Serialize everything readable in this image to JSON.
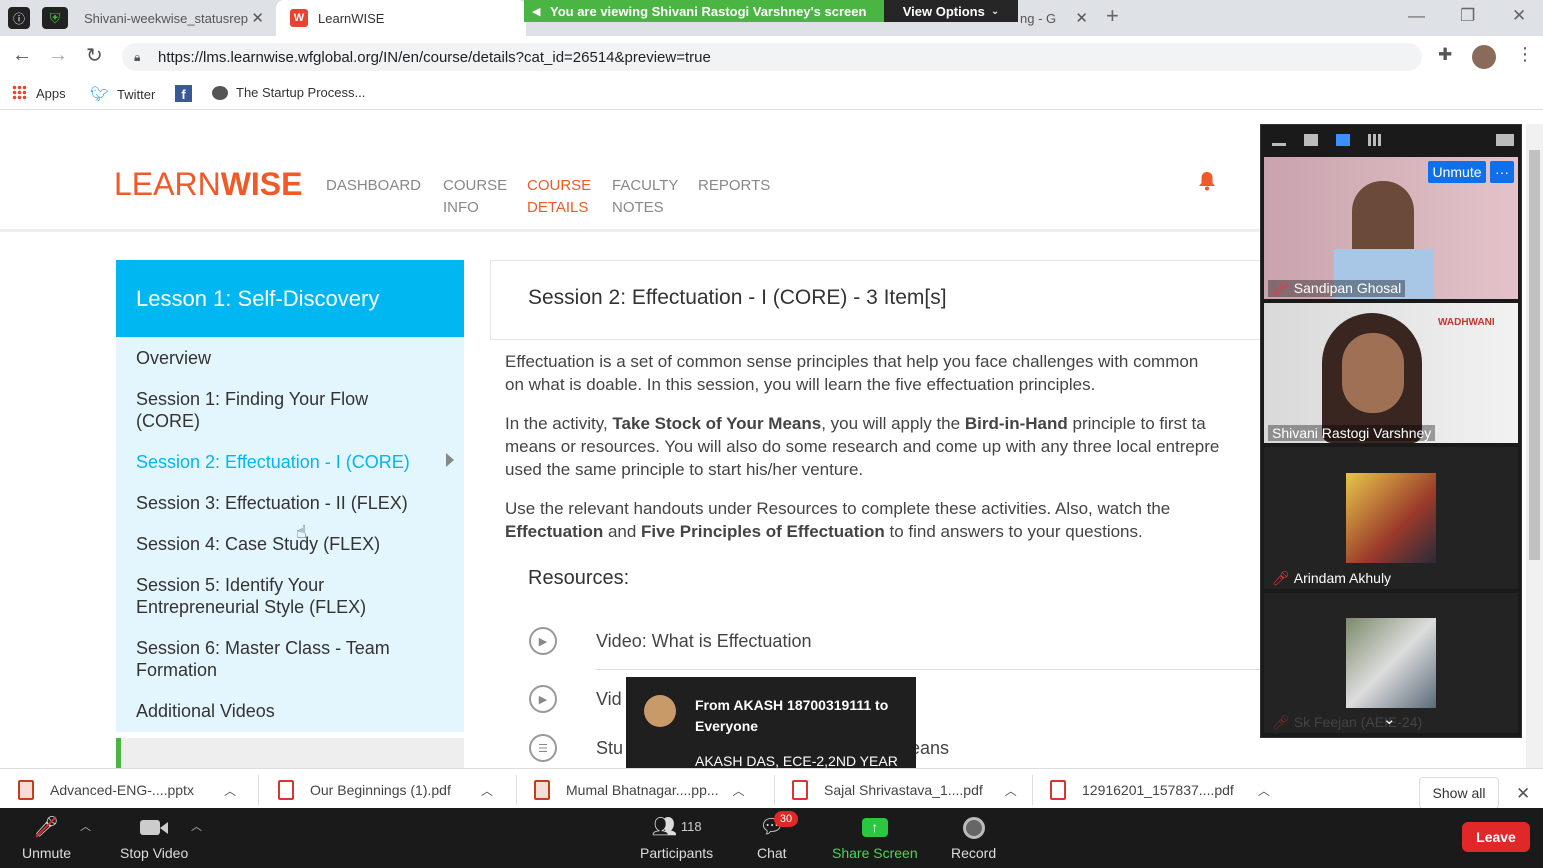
{
  "browser": {
    "tabs": [
      {
        "label": "Shivani-weekwise_statusrep"
      },
      {
        "label": "LearnWISE"
      },
      {
        "label": "ng - G"
      }
    ],
    "url": "https://lms.learnwise.wfglobal.org/IN/en/course/details?cat_id=26514&preview=true",
    "bookmarks": [
      "Apps",
      "Twitter",
      "The Startup Process..."
    ]
  },
  "share_banner": {
    "text": "You are viewing Shivani Rastogi Varshney's screen",
    "view_options": "View Options"
  },
  "site": {
    "logo_light": "LEARN",
    "logo_bold": "WISE",
    "nav": [
      {
        "line1": "DASHBOARD",
        "line2": ""
      },
      {
        "line1": "COURSE",
        "line2": "INFO"
      },
      {
        "line1": "COURSE",
        "line2": "DETAILS"
      },
      {
        "line1": "FACULTY",
        "line2": "NOTES"
      },
      {
        "line1": "REPORTS",
        "line2": ""
      }
    ]
  },
  "lesson": {
    "title": "Lesson 1: Self-Discovery",
    "items": [
      "Overview",
      "Session 1: Finding Your Flow (CORE)",
      "Session 2: Effectuation - I (CORE)",
      "Session 3: Effectuation - II (FLEX)",
      "Session 4: Case Study (FLEX)",
      "Session 5: Identify Your Entrepreneurial Style (FLEX)",
      "Session 6: Master Class - Team Formation",
      "Additional Videos"
    ]
  },
  "session": {
    "title": "Session 2: Effectuation - I (CORE) - 3 Item[s]",
    "p1_line1": "Effectuation is a set of common sense principles that help you face challenges with common",
    "p1_line2": "on what is doable. In this session, you will learn the five effectuation principles.",
    "p2_a": "In the activity, ",
    "p2_b": "Take Stock of Your Means",
    "p2_c": ", you will apply the ",
    "p2_d": "Bird-in-Hand",
    "p2_e": " principle to first ta",
    "p2_line2": "means or resources. You will also do some research and come up with any three local entrepre",
    "p2_line3": "used the same principle to start his/her venture.",
    "p3_line1": "Use the relevant handouts under Resources to complete these activities. Also, watch the",
    "p3_b1": "Effectuation",
    "p3_mid": " and ",
    "p3_b2": "Five Principles of Effectuation",
    "p3_end": " to find answers to your questions.",
    "resources_label": "Resources:",
    "resources": [
      "Video: What is Effectuation",
      "Vid",
      "Stu",
      "eans"
    ]
  },
  "chat_popup": {
    "from": "From AKASH 18700319111 to Everyone",
    "message": "AKASH DAS, ECE-2,2ND YEAR"
  },
  "video_panel": {
    "unmute": "Unmute",
    "more": "···",
    "participants": [
      "Sandipan Ghosal",
      "Shivani Rastogi Varshney",
      "Arindam Akhuly",
      "Sk Feejan (AEIE-24)"
    ],
    "watermark": "WADHWANI"
  },
  "downloads": {
    "files": [
      "Advanced-ENG-....pptx",
      "Our Beginnings (1).pdf",
      "Mumal Bhatnagar....pp...",
      "Sajal Shrivastava_1....pdf",
      "12916201_157837....pdf"
    ],
    "show_all": "Show all"
  },
  "zoom": {
    "unmute": "Unmute",
    "stop_video": "Stop Video",
    "participants_count": "118",
    "participants": "Participants",
    "chat": "Chat",
    "chat_badge": "30",
    "share_screen": "Share Screen",
    "record": "Record",
    "leave": "Leave"
  },
  "colors": {
    "brand_orange": "#ef5a28",
    "lesson_blue": "#00b7f1",
    "zoom_green": "#4bb543",
    "zoom_blue": "#0e71eb",
    "leave_red": "#e02828"
  }
}
